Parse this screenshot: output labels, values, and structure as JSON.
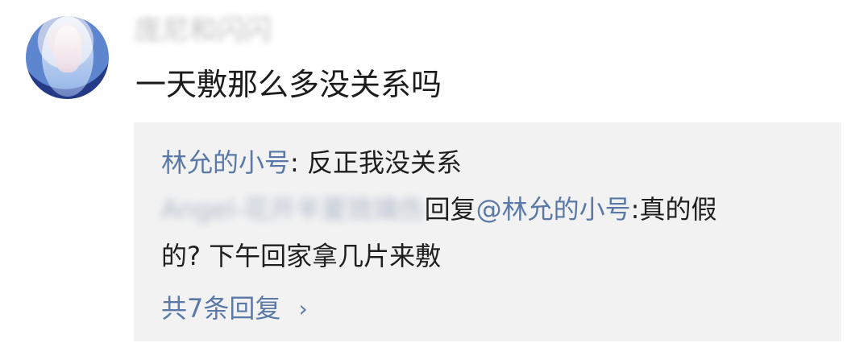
{
  "comment": {
    "username": "庞尼和闪闪",
    "text": "一天敷那么多没关系吗"
  },
  "replies": {
    "reply1": {
      "user": "林允的小号",
      "separator": ": ",
      "text": "反正我没关系"
    },
    "reply2": {
      "user": "Angel-花开半夏琉璃伤",
      "connector": "回复",
      "mention": "@林允的小号",
      "text_part1": ":真的假",
      "text_part2": "的? 下午回家拿几片来敷"
    },
    "more_label": "共7条回复",
    "more_icon": "chevron-right-icon"
  },
  "colors": {
    "background": "#ffffff",
    "reply_background": "#f2f2f2",
    "link": "#5b79a7",
    "text": "#1f1f1f"
  }
}
